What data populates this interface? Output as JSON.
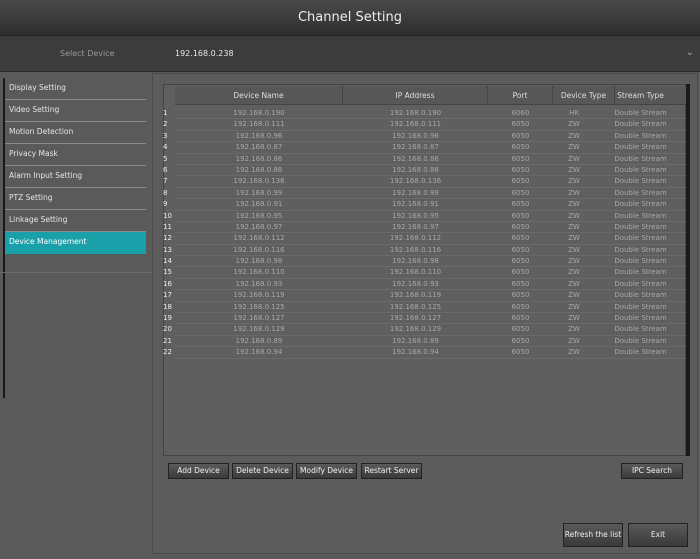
{
  "window": {
    "title": "Channel Setting"
  },
  "device_bar": {
    "label": "Select Device",
    "value": "192.168.0.238",
    "chevron": "chevron-down-icon"
  },
  "sidebar": {
    "items": [
      {
        "label": "Display Setting",
        "active": false
      },
      {
        "label": "Video Setting",
        "active": false
      },
      {
        "label": "Motion Detection",
        "active": false
      },
      {
        "label": "Privacy Mask",
        "active": false
      },
      {
        "label": "Alarm Input Setting",
        "active": false
      },
      {
        "label": "PTZ Setting",
        "active": false
      },
      {
        "label": "Linkage Setting",
        "active": false
      },
      {
        "label": "Device Management",
        "active": true
      }
    ]
  },
  "table": {
    "headers": [
      "Device Name",
      "IP Address",
      "Port",
      "Device Type",
      "Stream Type"
    ],
    "rows": [
      [
        "192.168.0.190",
        "192.168.0.190",
        "6060",
        "HK",
        "Double Stream"
      ],
      [
        "192.168.0.111",
        "192.168.0.111",
        "6050",
        "ZW",
        "Double Stream"
      ],
      [
        "192.168.0.96",
        "192.168.0.96",
        "6050",
        "ZW",
        "Double Stream"
      ],
      [
        "192.168.0.87",
        "192.168.0.87",
        "6050",
        "ZW",
        "Double Stream"
      ],
      [
        "192.168.0.86",
        "192.168.0.86",
        "6050",
        "ZW",
        "Double Stream"
      ],
      [
        "192.168.0.88",
        "192.168.0.88",
        "6050",
        "ZW",
        "Double Stream"
      ],
      [
        "192.168.0.136",
        "192.168.0.136",
        "6050",
        "ZW",
        "Double Stream"
      ],
      [
        "192.168.0.99",
        "192.168.0.99",
        "6050",
        "ZW",
        "Double Stream"
      ],
      [
        "192.168.0.91",
        "192.168.0.91",
        "6050",
        "ZW",
        "Double Stream"
      ],
      [
        "192.168.0.95",
        "192.168.0.95",
        "6050",
        "ZW",
        "Double Stream"
      ],
      [
        "192.168.0.97",
        "192.168.0.97",
        "6050",
        "ZW",
        "Double Stream"
      ],
      [
        "192.168.0.112",
        "192.168.0.112",
        "6050",
        "ZW",
        "Double Stream"
      ],
      [
        "192.168.0.116",
        "192.168.0.116",
        "6050",
        "ZW",
        "Double Stream"
      ],
      [
        "192.168.0.98",
        "192.168.0.98",
        "6050",
        "ZW",
        "Double Stream"
      ],
      [
        "192.168.0.110",
        "192.168.0.110",
        "6050",
        "ZW",
        "Double Stream"
      ],
      [
        "192.168.0.93",
        "192.168.0.93",
        "6050",
        "ZW",
        "Double Stream"
      ],
      [
        "192.168.0.119",
        "192.168.0.119",
        "6050",
        "ZW",
        "Double Stream"
      ],
      [
        "192.168.0.125",
        "192.168.0.125",
        "6050",
        "ZW",
        "Double Stream"
      ],
      [
        "192.168.0.127",
        "192.168.0.127",
        "6050",
        "ZW",
        "Double Stream"
      ],
      [
        "192.168.0.129",
        "192.168.0.129",
        "6050",
        "ZW",
        "Double Stream"
      ],
      [
        "192.168.0.89",
        "192.168.0.89",
        "6050",
        "ZW",
        "Double Stream"
      ],
      [
        "192.168.0.94",
        "192.168.0.94",
        "6050",
        "ZW",
        "Double Stream"
      ]
    ]
  },
  "buttons": {
    "add_device": "Add Device",
    "delete_device": "Delete Device",
    "modify_device": "Modify Device",
    "restart_server": "Restart Server",
    "ipc_search": "IPC Search",
    "refresh_list": "Refresh the list",
    "exit": "Exit"
  }
}
